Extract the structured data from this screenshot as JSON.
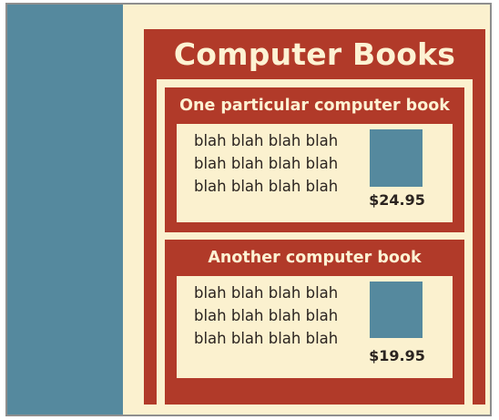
{
  "page": {
    "title": "Computer Books"
  },
  "books": [
    {
      "title": "One particular computer book",
      "lines": [
        "blah blah blah blah",
        "blah blah blah blah",
        "blah blah blah blah"
      ],
      "price": "$24.95"
    },
    {
      "title": "Another computer book",
      "lines": [
        "blah blah blah blah",
        "blah blah blah blah",
        "blah blah blah blah"
      ],
      "price": "$19.95"
    }
  ],
  "colors": {
    "background": "#fbf1cf",
    "accent": "#b13a29",
    "sidebar": "#55899e",
    "text": "#2b2420"
  }
}
